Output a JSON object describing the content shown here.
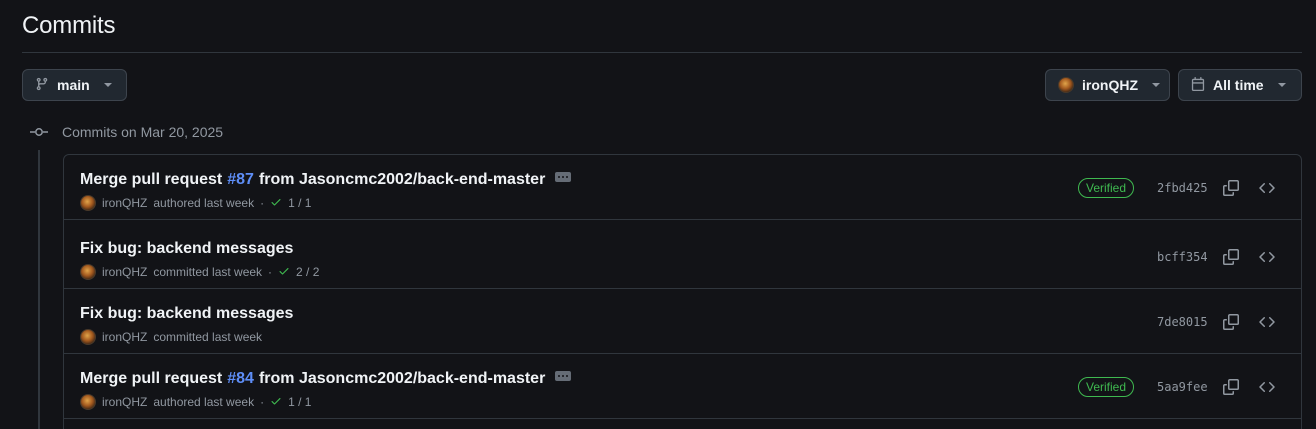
{
  "header": {
    "title": "Commits"
  },
  "filters": {
    "branch": {
      "label": "main",
      "icon": "git-branch-icon"
    },
    "author": {
      "label": "ironQHZ"
    },
    "time": {
      "label": "All time",
      "icon": "calendar-icon"
    }
  },
  "timeline": {
    "heading": "Commits on Mar 20, 2025"
  },
  "commits": [
    {
      "title_prefix": "Merge pull request",
      "pr": "#87",
      "title_suffix": "from Jasoncmc2002/back-end-master",
      "has_ellipsis": true,
      "author": "ironQHZ",
      "action": "authored last week",
      "separator": "·",
      "checks": "1 / 1",
      "verified": "Verified",
      "sha": "2fbd425"
    },
    {
      "title_prefix": "Fix bug: backend messages",
      "author": "ironQHZ",
      "action": "committed last week",
      "separator": "·",
      "checks": "2 / 2",
      "sha": "bcff354"
    },
    {
      "title_prefix": "Fix bug: backend messages",
      "author": "ironQHZ",
      "action": "committed last week",
      "sha": "7de8015"
    },
    {
      "title_prefix": "Merge pull request",
      "pr": "#84",
      "title_suffix": "from Jasoncmc2002/back-end-master",
      "has_ellipsis": true,
      "author": "ironQHZ",
      "action": "authored last week",
      "separator": "·",
      "checks": "1 / 1",
      "verified": "Verified",
      "sha": "5aa9fee"
    }
  ],
  "icons": {
    "copy": "copy-icon",
    "browse": "code-icon",
    "check": "check-icon",
    "commit_node": "git-commit-icon"
  },
  "colors": {
    "background": "#121317",
    "link": "#5e8ef7",
    "success": "#3fb950",
    "muted": "#9198a1",
    "border": "#30363d"
  }
}
